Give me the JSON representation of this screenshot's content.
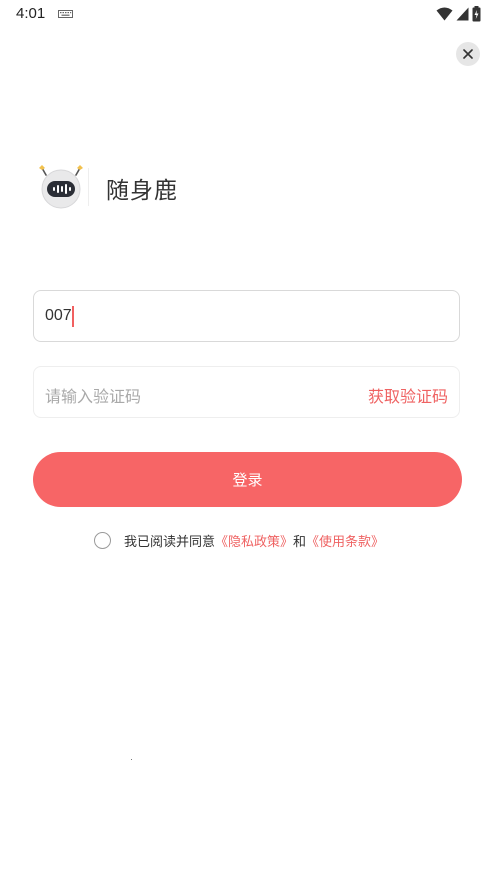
{
  "status_bar": {
    "time": "4:01",
    "icons": [
      "keyboard-icon",
      "wifi-icon",
      "signal-icon",
      "battery-charging-icon"
    ]
  },
  "header": {
    "close_icon": "close-icon"
  },
  "brand": {
    "logo_icon": "robot-avatar-icon",
    "app_name": "随身鹿"
  },
  "form": {
    "phone_value": "007",
    "code_placeholder": "请输入验证码",
    "get_code_label": "获取验证码",
    "login_label": "登录"
  },
  "agreement": {
    "text_prefix": "我已阅读并同意",
    "privacy_link": "《隐私政策》",
    "connector": "和",
    "terms_link": "《使用条款》"
  },
  "colors": {
    "accent": "#f76566",
    "link": "#ef6262",
    "border": "#d9d9d9"
  }
}
